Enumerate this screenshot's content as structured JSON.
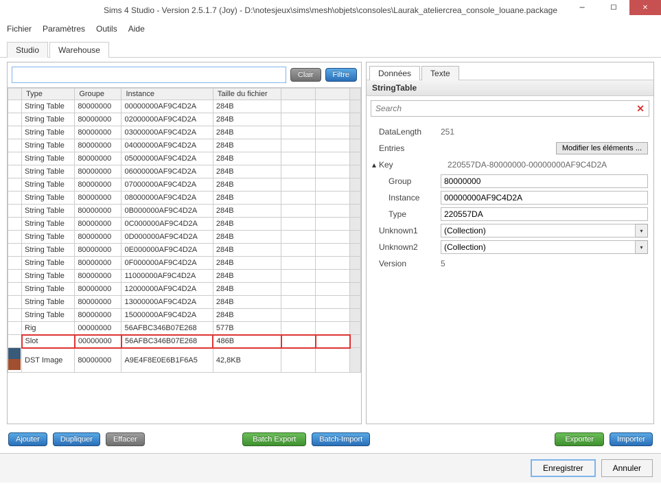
{
  "titlebar": {
    "title": "Sims 4 Studio - Version 2.5.1.7  (Joy)   - D:\\notesjeux\\sims\\mesh\\objets\\consoles\\Laurak_ateliercrea_console_louane.package"
  },
  "menu": {
    "file": "Fichier",
    "params": "Paramètres",
    "tools": "Outils",
    "help": "Aide"
  },
  "tabs": {
    "studio": "Studio",
    "warehouse": "Warehouse"
  },
  "filter": {
    "clear": "Clair",
    "filter": "Filtre"
  },
  "cols": {
    "type": "Type",
    "group": "Groupe",
    "instance": "Instance",
    "size": "Taille du fichier"
  },
  "rows": [
    {
      "type": "String Table",
      "group": "80000000",
      "instance": "00000000AF9C4D2A",
      "size": "284B"
    },
    {
      "type": "String Table",
      "group": "80000000",
      "instance": "02000000AF9C4D2A",
      "size": "284B"
    },
    {
      "type": "String Table",
      "group": "80000000",
      "instance": "03000000AF9C4D2A",
      "size": "284B"
    },
    {
      "type": "String Table",
      "group": "80000000",
      "instance": "04000000AF9C4D2A",
      "size": "284B"
    },
    {
      "type": "String Table",
      "group": "80000000",
      "instance": "05000000AF9C4D2A",
      "size": "284B"
    },
    {
      "type": "String Table",
      "group": "80000000",
      "instance": "06000000AF9C4D2A",
      "size": "284B"
    },
    {
      "type": "String Table",
      "group": "80000000",
      "instance": "07000000AF9C4D2A",
      "size": "284B"
    },
    {
      "type": "String Table",
      "group": "80000000",
      "instance": "08000000AF9C4D2A",
      "size": "284B"
    },
    {
      "type": "String Table",
      "group": "80000000",
      "instance": "0B000000AF9C4D2A",
      "size": "284B"
    },
    {
      "type": "String Table",
      "group": "80000000",
      "instance": "0C000000AF9C4D2A",
      "size": "284B"
    },
    {
      "type": "String Table",
      "group": "80000000",
      "instance": "0D000000AF9C4D2A",
      "size": "284B"
    },
    {
      "type": "String Table",
      "group": "80000000",
      "instance": "0E000000AF9C4D2A",
      "size": "284B"
    },
    {
      "type": "String Table",
      "group": "80000000",
      "instance": "0F000000AF9C4D2A",
      "size": "284B"
    },
    {
      "type": "String Table",
      "group": "80000000",
      "instance": "11000000AF9C4D2A",
      "size": "284B"
    },
    {
      "type": "String Table",
      "group": "80000000",
      "instance": "12000000AF9C4D2A",
      "size": "284B"
    },
    {
      "type": "String Table",
      "group": "80000000",
      "instance": "13000000AF9C4D2A",
      "size": "284B"
    },
    {
      "type": "String Table",
      "group": "80000000",
      "instance": "15000000AF9C4D2A",
      "size": "284B"
    },
    {
      "type": "Rig",
      "group": "00000000",
      "instance": "56AFBC346B07E268",
      "size": "577B"
    },
    {
      "type": "Slot",
      "group": "00000000",
      "instance": "56AFBC346B07E268",
      "size": "486B",
      "hl": true
    },
    {
      "type": "DST Image",
      "group": "80000000",
      "instance": "A9E4F8E0E6B1F6A5",
      "size": "42,8KB",
      "img": true
    }
  ],
  "actions": {
    "add": "Ajouter",
    "dup": "Dupliquer",
    "del": "Effacer",
    "batchExport": "Batch Export",
    "batchImport": "Batch-Import",
    "export": "Exporter",
    "import": "Importer"
  },
  "rightTabs": {
    "data": "Données",
    "text": "Texte"
  },
  "panel": {
    "title": "StringTable",
    "searchPlaceholder": "Search",
    "props": {
      "dataLengthLabel": "DataLength",
      "dataLength": "251",
      "entriesLabel": "Entries",
      "modifyBtn": "Modifier les éléments ...",
      "keyLabel": "Key",
      "keyVal": "220557DA-80000000-00000000AF9C4D2A",
      "groupLabel": "Group",
      "groupVal": "80000000",
      "instanceLabel": "Instance",
      "instanceVal": "00000000AF9C4D2A",
      "typeLabel": "Type",
      "typeVal": "220557DA",
      "unk1Label": "Unknown1",
      "unk1Val": "(Collection)",
      "unk2Label": "Unknown2",
      "unk2Val": "(Collection)",
      "versionLabel": "Version",
      "versionVal": "5"
    }
  },
  "dialog": {
    "save": "Enregistrer",
    "cancel": "Annuler"
  }
}
